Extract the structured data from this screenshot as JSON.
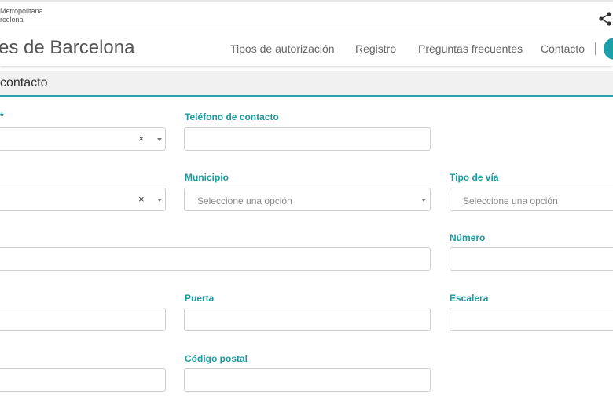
{
  "brand": {
    "logo_line1": "Metropolitana",
    "logo_line2": "rcelona"
  },
  "header": {
    "site_title": "es de Barcelona",
    "nav": [
      {
        "label": "Tipos de autorización"
      },
      {
        "label": "Registro"
      },
      {
        "label": "Preguntas frecuentes"
      },
      {
        "label": "Contacto"
      }
    ],
    "accent_color": "#1b9fa8"
  },
  "section": {
    "title": " contacto"
  },
  "form": {
    "labels": {
      "first": "*",
      "telefono": "Teléfono de contacto",
      "municipio": "Municipio",
      "tipo_via": "Tipo de vía",
      "numero": "Número",
      "puerta": "Puerta",
      "escalera": "Escalera",
      "codigo_postal": "Código postal"
    },
    "municipio_placeholder": "Seleccione una opción",
    "tipo_via_placeholder": "Seleccione una opción",
    "clear_symbol": "×",
    "label_color": "#1d9aa0"
  }
}
